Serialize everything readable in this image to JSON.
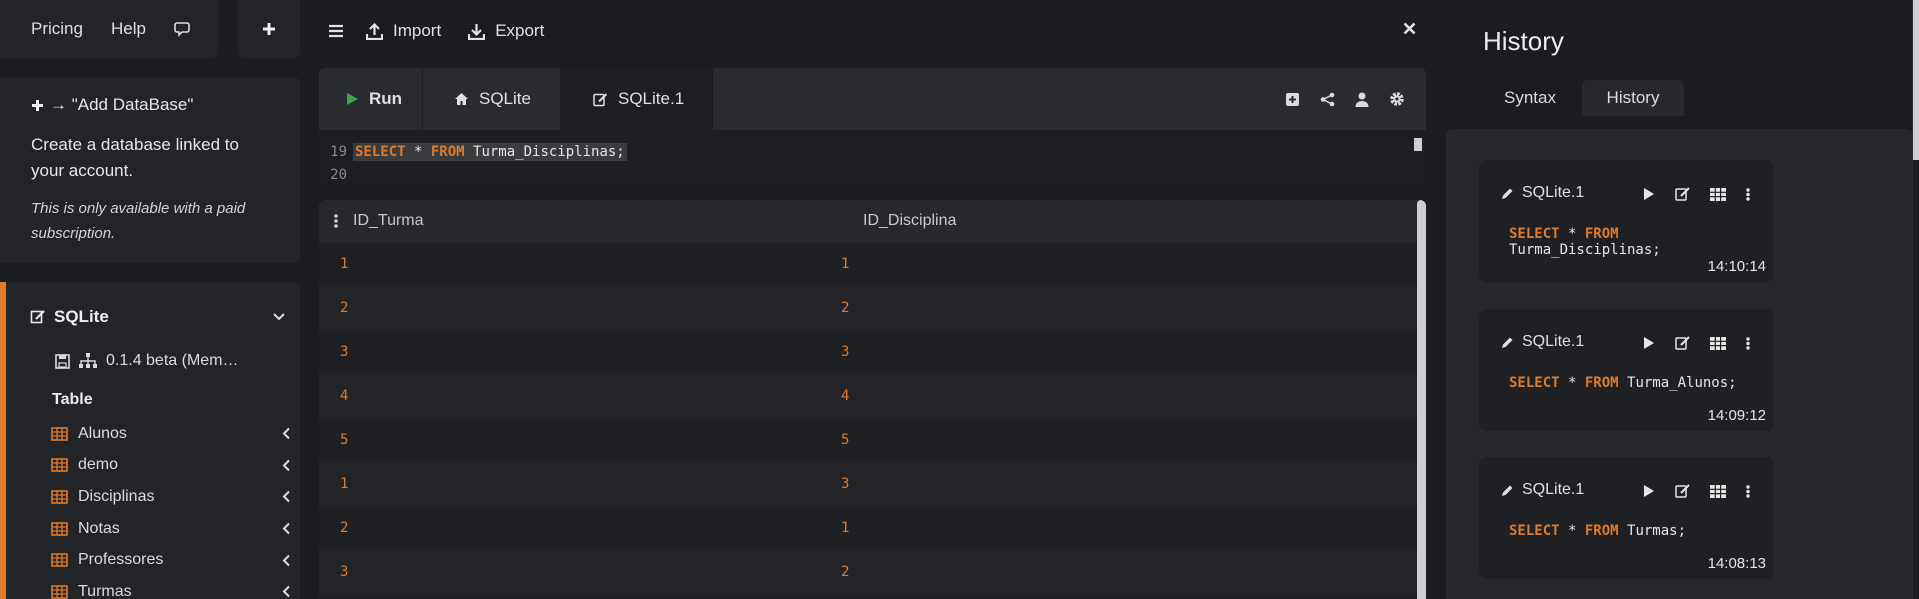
{
  "nav": {
    "pricing": "Pricing",
    "help": "Help"
  },
  "info": {
    "title": "→ \"Add DataBase\"",
    "description": "Create a database linked to your account.",
    "note": "This is only available with a paid subscription."
  },
  "database": {
    "name": "SQLite",
    "version": "0.1.4 beta (Mem…",
    "table_heading": "Table",
    "tables": [
      "Alunos",
      "demo",
      "Disciplinas",
      "Notas",
      "Professores",
      "Turmas"
    ]
  },
  "toolbar": {
    "import": "Import",
    "export": "Export"
  },
  "tabs": {
    "run": "Run",
    "sqlite": "SQLite",
    "sqlite1": "SQLite.1"
  },
  "editor": {
    "lines": [
      {
        "number": "19",
        "keyword1": "SELECT",
        "mid": " * ",
        "keyword2": "FROM",
        "rest": " Turma_Disciplinas;"
      },
      {
        "number": "20"
      }
    ]
  },
  "grid": {
    "columns": [
      "ID_Turma",
      "ID_Disciplina"
    ],
    "rows": [
      [
        "1",
        "1"
      ],
      [
        "2",
        "2"
      ],
      [
        "3",
        "3"
      ],
      [
        "4",
        "4"
      ],
      [
        "5",
        "5"
      ],
      [
        "1",
        "3"
      ],
      [
        "2",
        "1"
      ],
      [
        "3",
        "2"
      ]
    ]
  },
  "history": {
    "title": "History",
    "tabs": [
      "Syntax",
      "History"
    ],
    "entries": [
      {
        "db": "SQLite.1",
        "kw1": "SELECT",
        "mid": " * ",
        "kw2": "FROM",
        "target": " Turma_Disciplinas;",
        "time": "14:10:14"
      },
      {
        "db": "SQLite.1",
        "kw1": "SELECT",
        "mid": " * ",
        "kw2": "FROM",
        "target": " Turma_Alunos;",
        "time": "14:09:12"
      },
      {
        "db": "SQLite.1",
        "kw1": "SELECT",
        "mid": " * ",
        "kw2": "FROM",
        "target": " Turmas;",
        "time": "14:08:13"
      }
    ]
  },
  "colors": {
    "accent": "#e07a2c",
    "run_green": "#43a047",
    "table_icon": "#e07a2c"
  }
}
